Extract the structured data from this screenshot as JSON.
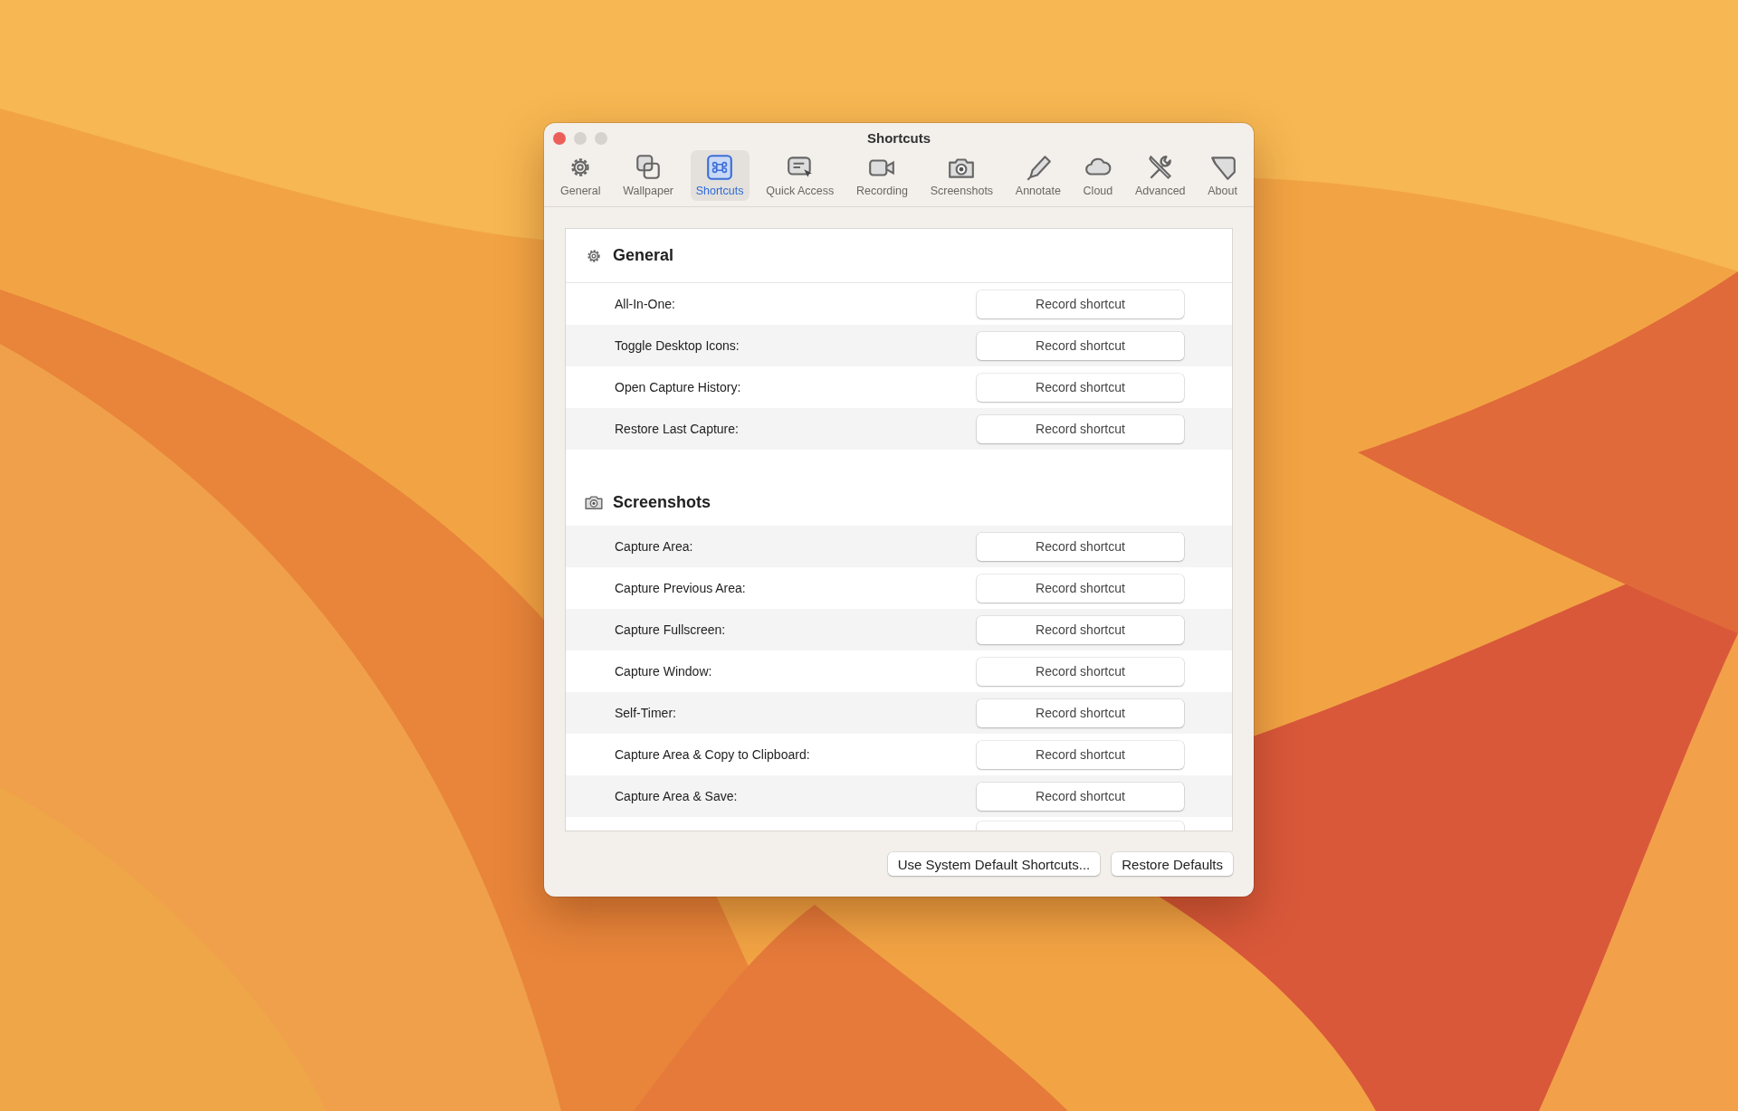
{
  "window": {
    "title": "Shortcuts"
  },
  "tabs": [
    {
      "label": "General",
      "selected": false
    },
    {
      "label": "Wallpaper",
      "selected": false
    },
    {
      "label": "Shortcuts",
      "selected": true
    },
    {
      "label": "Quick Access",
      "selected": false
    },
    {
      "label": "Recording",
      "selected": false
    },
    {
      "label": "Screenshots",
      "selected": false
    },
    {
      "label": "Annotate",
      "selected": false
    },
    {
      "label": "Cloud",
      "selected": false
    },
    {
      "label": "Advanced",
      "selected": false
    },
    {
      "label": "About",
      "selected": false
    }
  ],
  "sections": [
    {
      "title": "General",
      "rows": [
        {
          "kind": "shortcut",
          "label": "All-In-One:",
          "button": "Record shortcut"
        },
        {
          "kind": "shortcut",
          "label": "Toggle Desktop Icons:",
          "button": "Record shortcut"
        },
        {
          "kind": "shortcut",
          "label": "Open Capture History:",
          "button": "Record shortcut"
        },
        {
          "kind": "shortcut",
          "label": "Restore Last Capture:",
          "button": "Record shortcut"
        }
      ]
    },
    {
      "title": "Screenshots",
      "rows": [
        {
          "kind": "shortcut",
          "label": "Capture Area:",
          "button": "Record shortcut"
        },
        {
          "kind": "shortcut",
          "label": "Capture Previous Area:",
          "button": "Record shortcut"
        },
        {
          "kind": "shortcut",
          "label": "Capture Fullscreen:",
          "button": "Record shortcut"
        },
        {
          "kind": "shortcut",
          "label": "Capture Window:",
          "button": "Record shortcut"
        },
        {
          "kind": "shortcut",
          "label": "Self-Timer:",
          "button": "Record shortcut"
        },
        {
          "kind": "shortcut",
          "label": "Capture Area & Copy to Clipboard:",
          "button": "Record shortcut"
        },
        {
          "kind": "shortcut",
          "label": "Capture Area & Save:",
          "button": "Record shortcut"
        },
        {
          "kind": "cut"
        }
      ]
    }
  ],
  "footer_buttons": [
    "Use System Default Shortcuts...",
    "Restore Defaults"
  ]
}
